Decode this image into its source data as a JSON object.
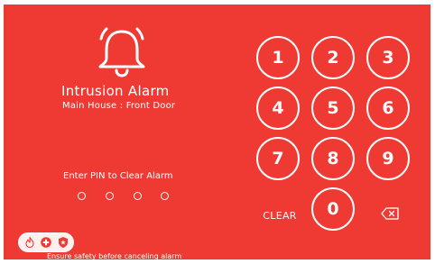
{
  "alarm": {
    "icon": "bell-icon",
    "title": "Intrusion Alarm",
    "location": "Main House : Front Door",
    "background_color": "#ee3a33"
  },
  "pin_entry": {
    "prompt": "Enter PIN to Clear Alarm",
    "digits_total": 4,
    "digits_entered": 0
  },
  "keypad": {
    "keys": [
      "1",
      "2",
      "3",
      "4",
      "5",
      "6",
      "7",
      "8",
      "9",
      "0"
    ],
    "clear_label": "CLEAR",
    "backspace_icon": "backspace-icon"
  },
  "footer": {
    "icons": [
      "fire-icon",
      "medical-icon",
      "police-shield-icon"
    ],
    "text": "Ensure safety before canceling alarm"
  }
}
